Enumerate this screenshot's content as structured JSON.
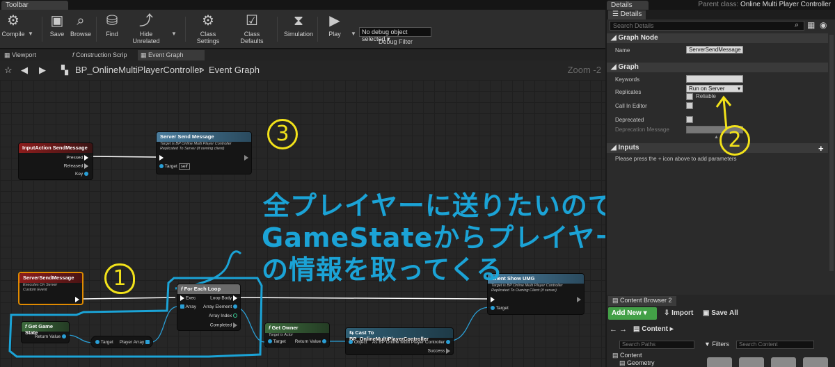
{
  "top": {
    "toolbar_tab": "Toolbar",
    "details_tab": "Details",
    "parent_class_label": "Parent class:",
    "parent_class_value": "Online Multi Player Controller"
  },
  "toolbar": {
    "compile": "Compile",
    "save": "Save",
    "browse": "Browse",
    "find": "Find",
    "hide_unrelated": "Hide Unrelated",
    "class_settings": "Class Settings",
    "class_defaults": "Class Defaults",
    "simulation": "Simulation",
    "play": "Play",
    "debug_select": "No debug object selected",
    "debug_filter": "Debug Filter"
  },
  "doc_tabs": [
    "Viewport",
    "Construction Scrip",
    "Event Graph"
  ],
  "breadcrumb": {
    "blueprint": "BP_OnlineMultiPlayerController",
    "sep": ">",
    "graph": "Event Graph",
    "zoom": "Zoom -2"
  },
  "nodes": {
    "input_action": {
      "title": "InputAction SendMessage",
      "pins": [
        "Pressed",
        "Released",
        "Key"
      ]
    },
    "server_send": {
      "title": "Server Send Message",
      "sub1": "Target is BP Online Multi Player Controller",
      "sub2": "Replicated To Server (if owning client)",
      "target": "Target",
      "self": "self"
    },
    "server_event": {
      "title": "ServerSendMessage",
      "sub1": "Executes On Server",
      "sub2": "Custom Event"
    },
    "for_each": {
      "title": "For Each Loop",
      "exec": "Exec",
      "array": "Array",
      "loop_body": "Loop Body",
      "array_element": "Array Element",
      "array_index": "Array Index",
      "completed": "Completed"
    },
    "get_game_state": {
      "title": "Get Game State",
      "return": "Return Value"
    },
    "player_array": {
      "target": "Target",
      "array": "Player Array"
    },
    "get_owner": {
      "title": "Get Owner",
      "sub": "Target is Actor",
      "target": "Target",
      "return": "Return Value"
    },
    "cast": {
      "title": "Cast To BP_OnlineMultiPlayerController",
      "object": "Object",
      "as": "As BP Online Multi Player Controller",
      "success": "Success"
    },
    "client_show": {
      "title": "Client Show UMG",
      "sub1": "Target is BP Online Multi Player Controller",
      "sub2": "Replicated To Owning Client (if server)",
      "target": "Target"
    }
  },
  "annotations": {
    "line1": "全プレイヤーに送りたいので",
    "line2": "GameStateからプレイヤー全員",
    "line3": "の情報を取ってくる",
    "num1": "1",
    "num2": "2",
    "num3": "3"
  },
  "details": {
    "search_placeholder": "Search Details",
    "graph_node_section": "Graph Node",
    "name_label": "Name",
    "name_value": "ServerSendMessage",
    "graph_section": "Graph",
    "keywords": "Keywords",
    "replicates": "Replicates",
    "replicates_value": "Run on Server",
    "reliable": "Reliable",
    "call_in_editor": "Call In Editor",
    "deprecated": "Deprecated",
    "deprecation_message": "Deprecation Message",
    "inputs_section": "Inputs",
    "inputs_hint": "Please press the + icon above to add parameters"
  },
  "content_browser": {
    "tab": "Content Browser 2",
    "add_new": "Add New",
    "import": "Import",
    "save_all": "Save All",
    "path": "Content",
    "search_paths": "Search Paths",
    "filters": "Filters",
    "search_content": "Search Content",
    "tree": [
      "Content",
      "Geometry"
    ]
  },
  "colors": {
    "accent_blue": "#1ba3d6",
    "annotation_yellow": "#f2e21a",
    "event_red": "#8c1c1c",
    "func_blue": "#3a6b8c",
    "pure_green": "#3d6b3d"
  }
}
